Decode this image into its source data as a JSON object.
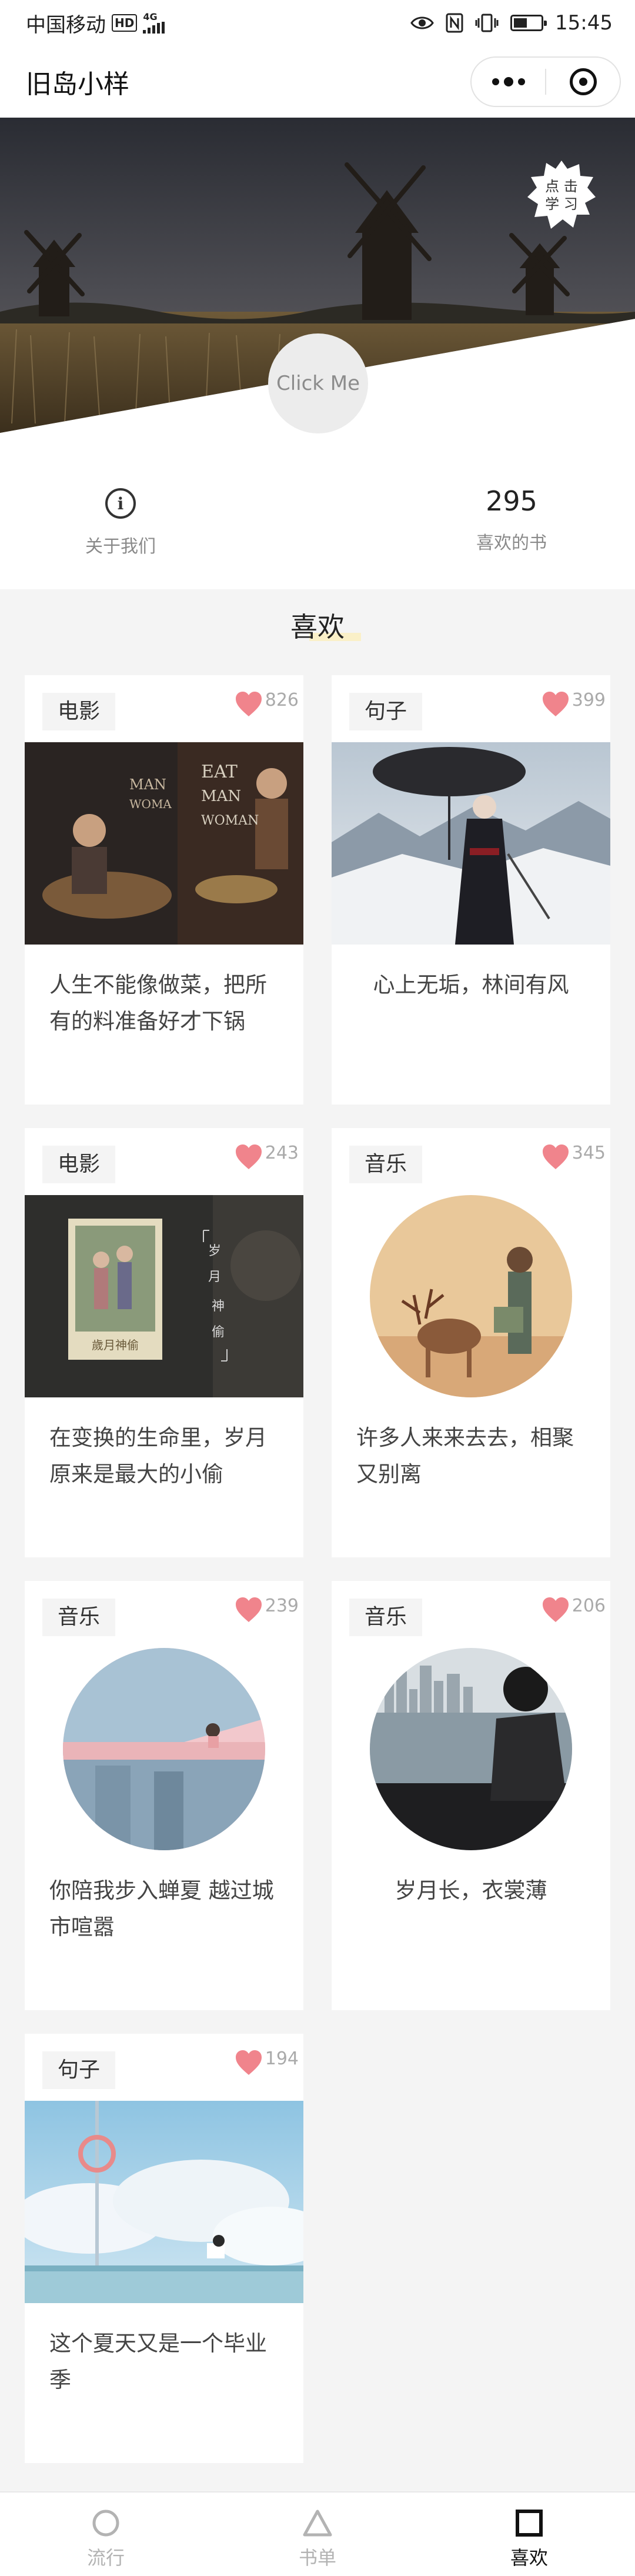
{
  "status_bar": {
    "carrier": "中国移动",
    "badge_hd": "HD",
    "badge_net": "4G",
    "time": "15:45",
    "icons": [
      "hd-icon",
      "signal-icon",
      "eye-icon",
      "nfc-icon",
      "vibrate-icon",
      "battery-icon"
    ]
  },
  "nav": {
    "title": "旧岛小样"
  },
  "banner": {
    "button_label": "Click Me",
    "stamp_text": "点击学习"
  },
  "stats": {
    "about_label": "关于我们",
    "book_count": "295",
    "book_label": "喜欢的书"
  },
  "section": {
    "title": "喜欢"
  },
  "cards": [
    {
      "tag": "电影",
      "likes": "826",
      "text": "人生不能像做菜，把所有的料准备好才下锅",
      "image": "movie-eat-drink-man-woman"
    },
    {
      "tag": "句子",
      "likes": "399",
      "text": "心上无垢，林间有风",
      "image": "woman-umbrella-snow"
    },
    {
      "tag": "电影",
      "likes": "243",
      "text": "在变换的生命里，岁月原来是最大的小偷",
      "image": "movie-poster-years",
      "image_text": [
        "岁",
        "月",
        "神",
        "偷"
      ],
      "poster_text": "歲月神偷"
    },
    {
      "tag": "音乐",
      "likes": "345",
      "text": "许多人来来去去，相聚又别离",
      "image": "traveler-deer-circle"
    },
    {
      "tag": "音乐",
      "likes": "239",
      "text": "你陪我步入蝉夏 越过城市喧嚣",
      "image": "girl-balcony-circle"
    },
    {
      "tag": "音乐",
      "likes": "206",
      "text": "岁月长，衣裳薄",
      "image": "girl-city-bay-circle"
    },
    {
      "tag": "句子",
      "likes": "194",
      "text": "这个夏天又是一个毕业季",
      "image": "summer-sky-cat"
    }
  ],
  "tabs": [
    {
      "label": "流行",
      "icon": "circle-icon",
      "active": false
    },
    {
      "label": "书单",
      "icon": "triangle-icon",
      "active": false
    },
    {
      "label": "喜欢",
      "icon": "square-icon",
      "active": true
    }
  ],
  "colors": {
    "heart": "#f0848c",
    "accent_underline": "#faf0c8",
    "background": "#f4f4f4"
  }
}
